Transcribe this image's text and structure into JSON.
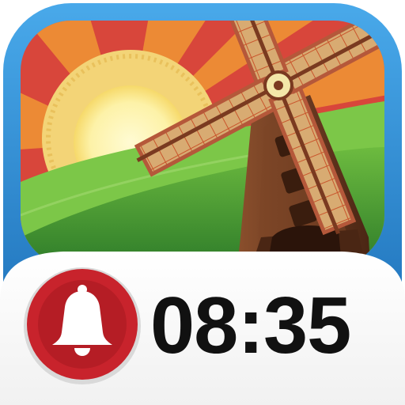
{
  "app_icon": {
    "icon_name": "alarm-clock-windmill-app-icon",
    "bell_icon": "bell-icon",
    "time_display": "08:35",
    "colors": {
      "frame_blue": "#1f82cc",
      "badge_red": "#c8232c",
      "sky_red": "#d8463b",
      "sky_orange": "#ec8a35",
      "sun_yellow": "#fdf2a8",
      "hill_green": "#55a535",
      "windmill_brown": "#6b3a21",
      "sail_tan": "#d3a46a",
      "panel_white": "#ffffff",
      "time_black": "#111111"
    }
  }
}
